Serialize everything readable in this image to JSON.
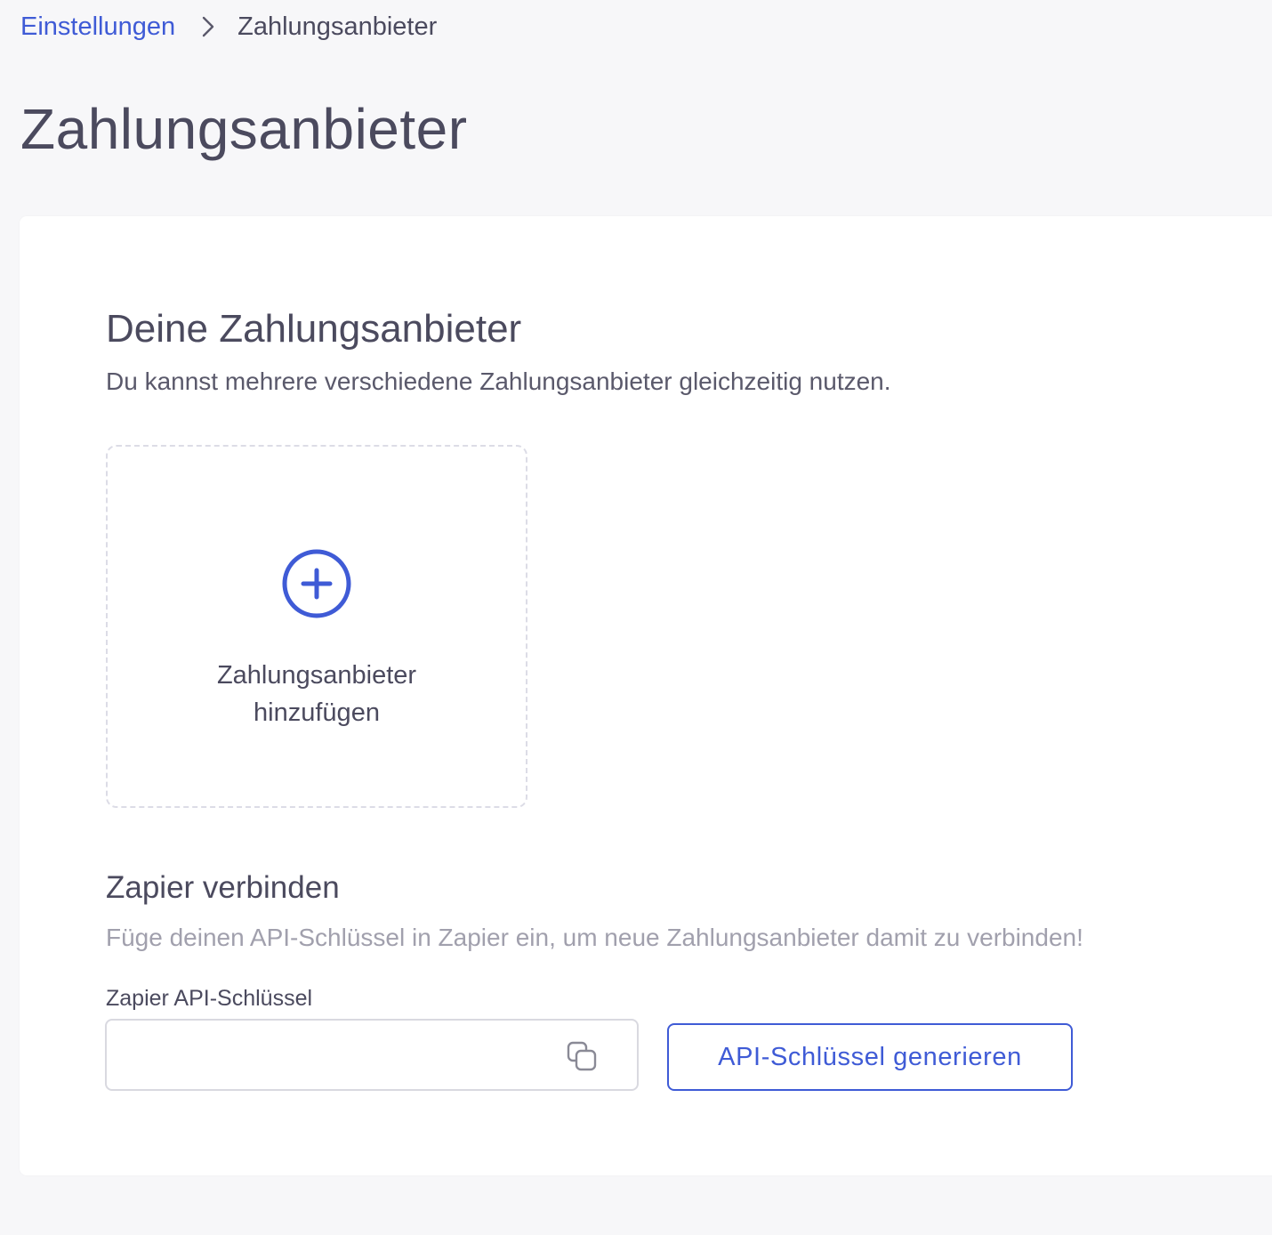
{
  "breadcrumb": {
    "parent": "Einstellungen",
    "current": "Zahlungsanbieter"
  },
  "page": {
    "title": "Zahlungsanbieter"
  },
  "providers": {
    "title": "Deine Zahlungsanbieter",
    "description": "Du kannst mehrere verschiedene Zahlungsanbieter gleichzeitig nutzen.",
    "add_label": "Zahlungsanbieter hinzufügen",
    "add_icon": "plus-circle-icon"
  },
  "zapier": {
    "title": "Zapier verbinden",
    "description": "Füge deinen API-Schlüssel in Zapier ein, um neue Zahlungsanbieter damit zu verbinden!",
    "field_label": "Zapier API-Schlüssel",
    "field_value": "",
    "copy_icon": "copy-icon",
    "generate_label": "API-Schlüssel generieren"
  },
  "colors": {
    "accent": "#3f5bd6",
    "text": "#4b4a5e",
    "muted": "#a1a0ad",
    "background": "#f7f7f9"
  }
}
